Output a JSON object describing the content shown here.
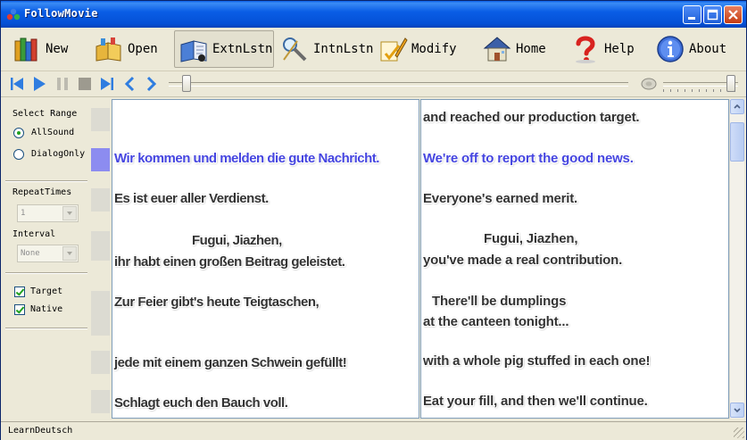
{
  "window": {
    "title": "FollowMovie"
  },
  "toolbar": {
    "new": "New",
    "open": "Open",
    "extnlstn": "ExtnLstn",
    "intnlstn": "IntnLstn",
    "modify": "Modify",
    "home": "Home",
    "help": "Help",
    "about": "About"
  },
  "left": {
    "select_range": "Select Range",
    "all_sound": "AllSound",
    "dialog_only": "DialogOnly",
    "repeat_times": "RepeatTimes",
    "repeat_value": "1",
    "interval": "Interval",
    "interval_value": "None",
    "target": "Target",
    "native": "Native"
  },
  "german": {
    "l1": "Wir kommen und melden die gute Nachricht.",
    "l2": "Es ist euer aller Verdienst.",
    "l3a": "Fugui, Jiazhen,",
    "l3b": "ihr habt einen großen Beitrag geleistet.",
    "l4": "Zur Feier gibt's heute Teigtaschen,",
    "l5": "jede mit einem ganzen Schwein gefüllt!",
    "l6": "Schlagt euch den Bauch voll."
  },
  "english": {
    "l0": "and reached our production target.",
    "l1": "We're off to report the good news.",
    "l2": "Everyone's earned merit.",
    "l3a": "Fugui, Jiazhen,",
    "l3b": "you've made a real contribution.",
    "l4a": "There'll be dumplings",
    "l4b": "at the canteen tonight...",
    "l5": "with a whole pig stuffed in each one!",
    "l6": "Eat your fill, and then we'll continue."
  },
  "status": {
    "text": "LearnDeutsch"
  },
  "colors": {
    "highlight": "#4545e0",
    "titlebar": "#0a5ee6"
  },
  "playback": {
    "seek_position": 0.03,
    "volume": 0.85
  }
}
